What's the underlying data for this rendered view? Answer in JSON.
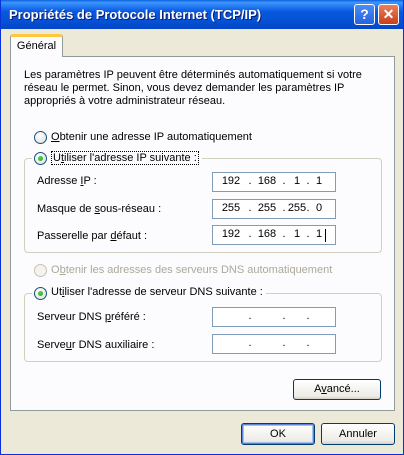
{
  "window": {
    "title": "Propriétés de Protocole Internet (TCP/IP)",
    "help_glyph": "?",
    "close_glyph": "✕"
  },
  "tab": {
    "label": "Général"
  },
  "description": "Les paramètres IP peuvent être déterminés automatiquement si votre réseau le permet. Sinon, vous devez demander les paramètres IP appropriés à votre administrateur réseau.",
  "ip": {
    "auto_label": "btenir une adresse IP automatiquement",
    "auto_mnemonic": "O",
    "manual_label_pre": "U",
    "manual_mnemonic": "t",
    "manual_label_post": "iliser l'adresse IP suivante :",
    "selected": "manual",
    "fields": [
      {
        "label_pre": "Adresse ",
        "mnemonic": "I",
        "label_post": "P :",
        "octets": [
          "192",
          "168",
          "1",
          "1"
        ]
      },
      {
        "label_pre": "Masque de ",
        "mnemonic": "s",
        "label_post": "ous-réseau :",
        "octets": [
          "255",
          "255",
          "255",
          "0"
        ]
      },
      {
        "label_pre": "Passerelle par ",
        "mnemonic": "d",
        "label_post": "éfaut :",
        "octets": [
          "192",
          "168",
          "1",
          "1"
        ]
      }
    ]
  },
  "dns": {
    "auto_label_pre": "O",
    "auto_mnemonic": "b",
    "auto_label_post": "tenir les adresses des serveurs DNS automatiquement",
    "manual_label_pre": "Ut",
    "manual_mnemonic": "i",
    "manual_label_post": "liser l'adresse de serveur DNS suivante :",
    "selected": "manual",
    "fields": [
      {
        "label_pre": "Serveur DNS ",
        "mnemonic": "p",
        "label_post": "référé :",
        "octets": [
          "",
          "",
          "",
          ""
        ]
      },
      {
        "label_pre": "Serve",
        "mnemonic": "u",
        "label_post": "r DNS auxiliaire :",
        "octets": [
          "",
          "",
          "",
          ""
        ]
      }
    ]
  },
  "buttons": {
    "advanced_pre": "A",
    "advanced_mnemonic": "v",
    "advanced_post": "ancé...",
    "ok": "OK",
    "cancel": "Annuler"
  },
  "colors": {
    "titlebar": "#0054E3",
    "dialog_bg": "#ECE9D8",
    "radio_dot": "#21A121"
  }
}
